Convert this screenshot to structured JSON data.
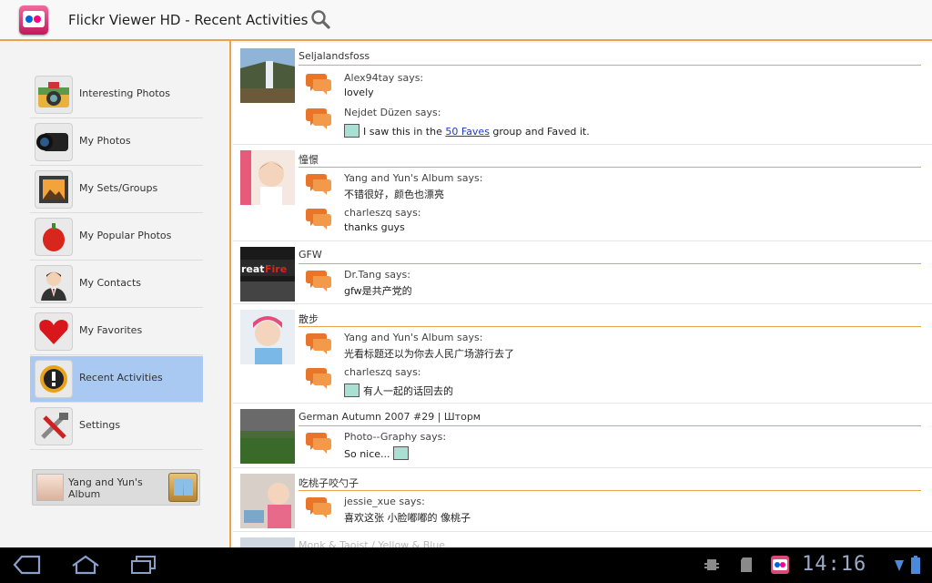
{
  "app": {
    "title": "Flickr Viewer HD - Recent Activities",
    "icon": "flickr-app-icon"
  },
  "sidebar": {
    "items": [
      {
        "label": "Interesting Photos",
        "icon": "camera-icon"
      },
      {
        "label": "My Photos",
        "icon": "lens-icon"
      },
      {
        "label": "My Sets/Groups",
        "icon": "picture-frame-icon"
      },
      {
        "label": "My Popular Photos",
        "icon": "pepper-icon"
      },
      {
        "label": "My Contacts",
        "icon": "contact-person-icon"
      },
      {
        "label": "My Favorites",
        "icon": "heart-icon"
      },
      {
        "label": "Recent Activities",
        "icon": "alert-icon",
        "active": true
      },
      {
        "label": "Settings",
        "icon": "tools-icon"
      }
    ],
    "account": {
      "name": "Yang and Yun's Album"
    }
  },
  "feed": {
    "groups": [
      {
        "title": "Seljalandsfoss",
        "comments": [
          {
            "author": "Alex94tay says:",
            "text": "lovely"
          },
          {
            "author": "Nejdet Düzen says:",
            "text_pre": "I saw this in the ",
            "link": "50 Faves",
            "text_post": " group and Faved it."
          }
        ]
      },
      {
        "title": "憧憬",
        "comments": [
          {
            "author": "Yang and Yun's Album says:",
            "text": "不错很好，颜色也漂亮"
          },
          {
            "author": "charleszq says:",
            "text": "thanks guys"
          }
        ]
      },
      {
        "title": "GFW",
        "comments": [
          {
            "author": "Dr.Tang says:",
            "text": "gfw是共产党的"
          }
        ]
      },
      {
        "title": "散步",
        "comments": [
          {
            "author": "Yang and Yun's Album says:",
            "text": "光看标题还以为你去人民广场游行去了"
          },
          {
            "author": "charleszq says:",
            "text": "有人一起的话回去的"
          }
        ]
      },
      {
        "title": "German Autumn 2007 #29 | Шторм",
        "comments": [
          {
            "author": "Photo--Graphy says:",
            "text": "So nice..."
          }
        ]
      },
      {
        "title": "吃桃子咬勺子",
        "comments": [
          {
            "author": "jessie_xue says:",
            "text": "喜欢这张 小脸嘟嘟的 像桃子"
          }
        ]
      },
      {
        "title": "Monk & Taoist / Yellow & Blue"
      }
    ]
  },
  "system": {
    "time": "14:16"
  },
  "colors": {
    "accent": "#e9a44a",
    "active": "#a9c8f2",
    "link": "#1a3cbd"
  }
}
